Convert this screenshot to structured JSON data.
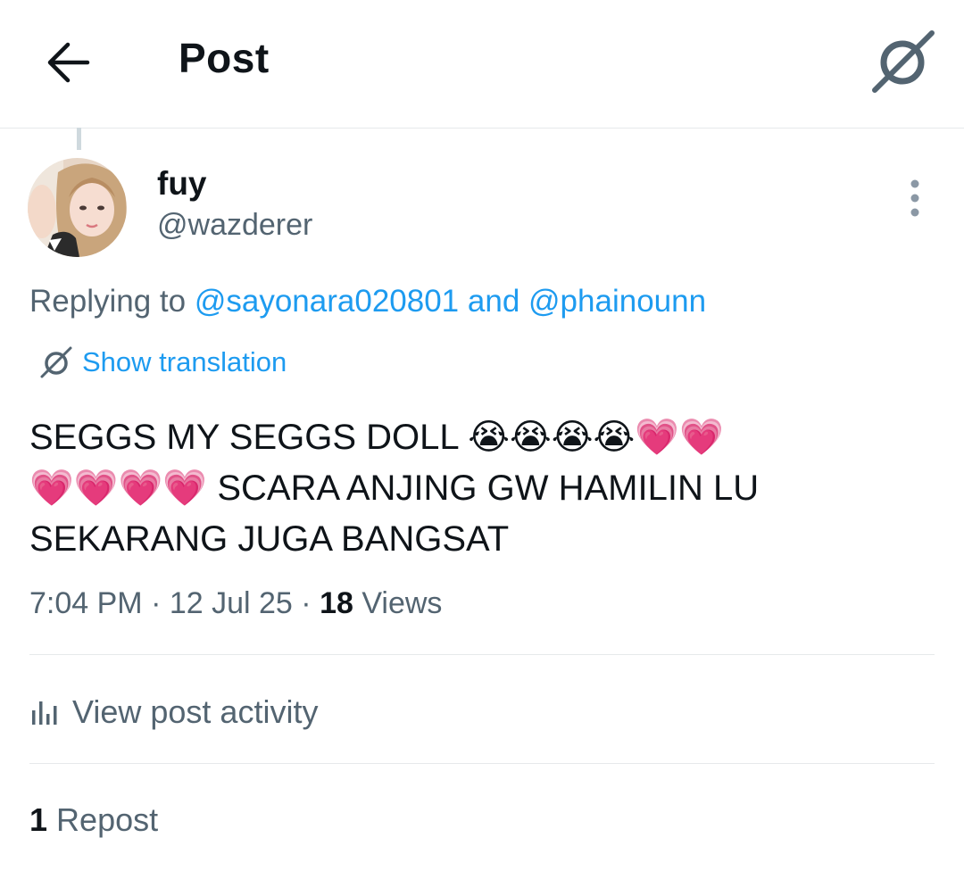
{
  "header": {
    "title": "Post",
    "back_icon": "arrow-left-icon",
    "grok_icon": "grok-icon"
  },
  "author": {
    "display_name": "fuy",
    "handle": "@wazderer",
    "avatar": "avatar-image"
  },
  "reply": {
    "prefix": "Replying to",
    "mention_1": "@sayonara020801",
    "conjunction": "and",
    "mention_2": "@phainounn"
  },
  "translation": {
    "label": "Show translation",
    "icon": "grok-icon"
  },
  "post": {
    "text": "SEGGS MY SEGGS DOLL 😭😭😭😭💗💗\n💗💗💗💗 SCARA ANJING GW HAMILIN LU\nSEKARANG JUGA BANGSAT"
  },
  "meta": {
    "time": "7:04 PM",
    "sep1": " · ",
    "date": "12 Jul 25",
    "sep2": " · ",
    "views_count": "18",
    "views_label": "Views"
  },
  "activity": {
    "label": "View post activity",
    "icon": "bar-chart-icon"
  },
  "reposts": {
    "count": "1",
    "label": "Repost"
  },
  "colors": {
    "accent": "#1d9bf0",
    "text_primary": "#0f1419",
    "text_secondary": "#536471",
    "divider": "#e6e9eb"
  }
}
